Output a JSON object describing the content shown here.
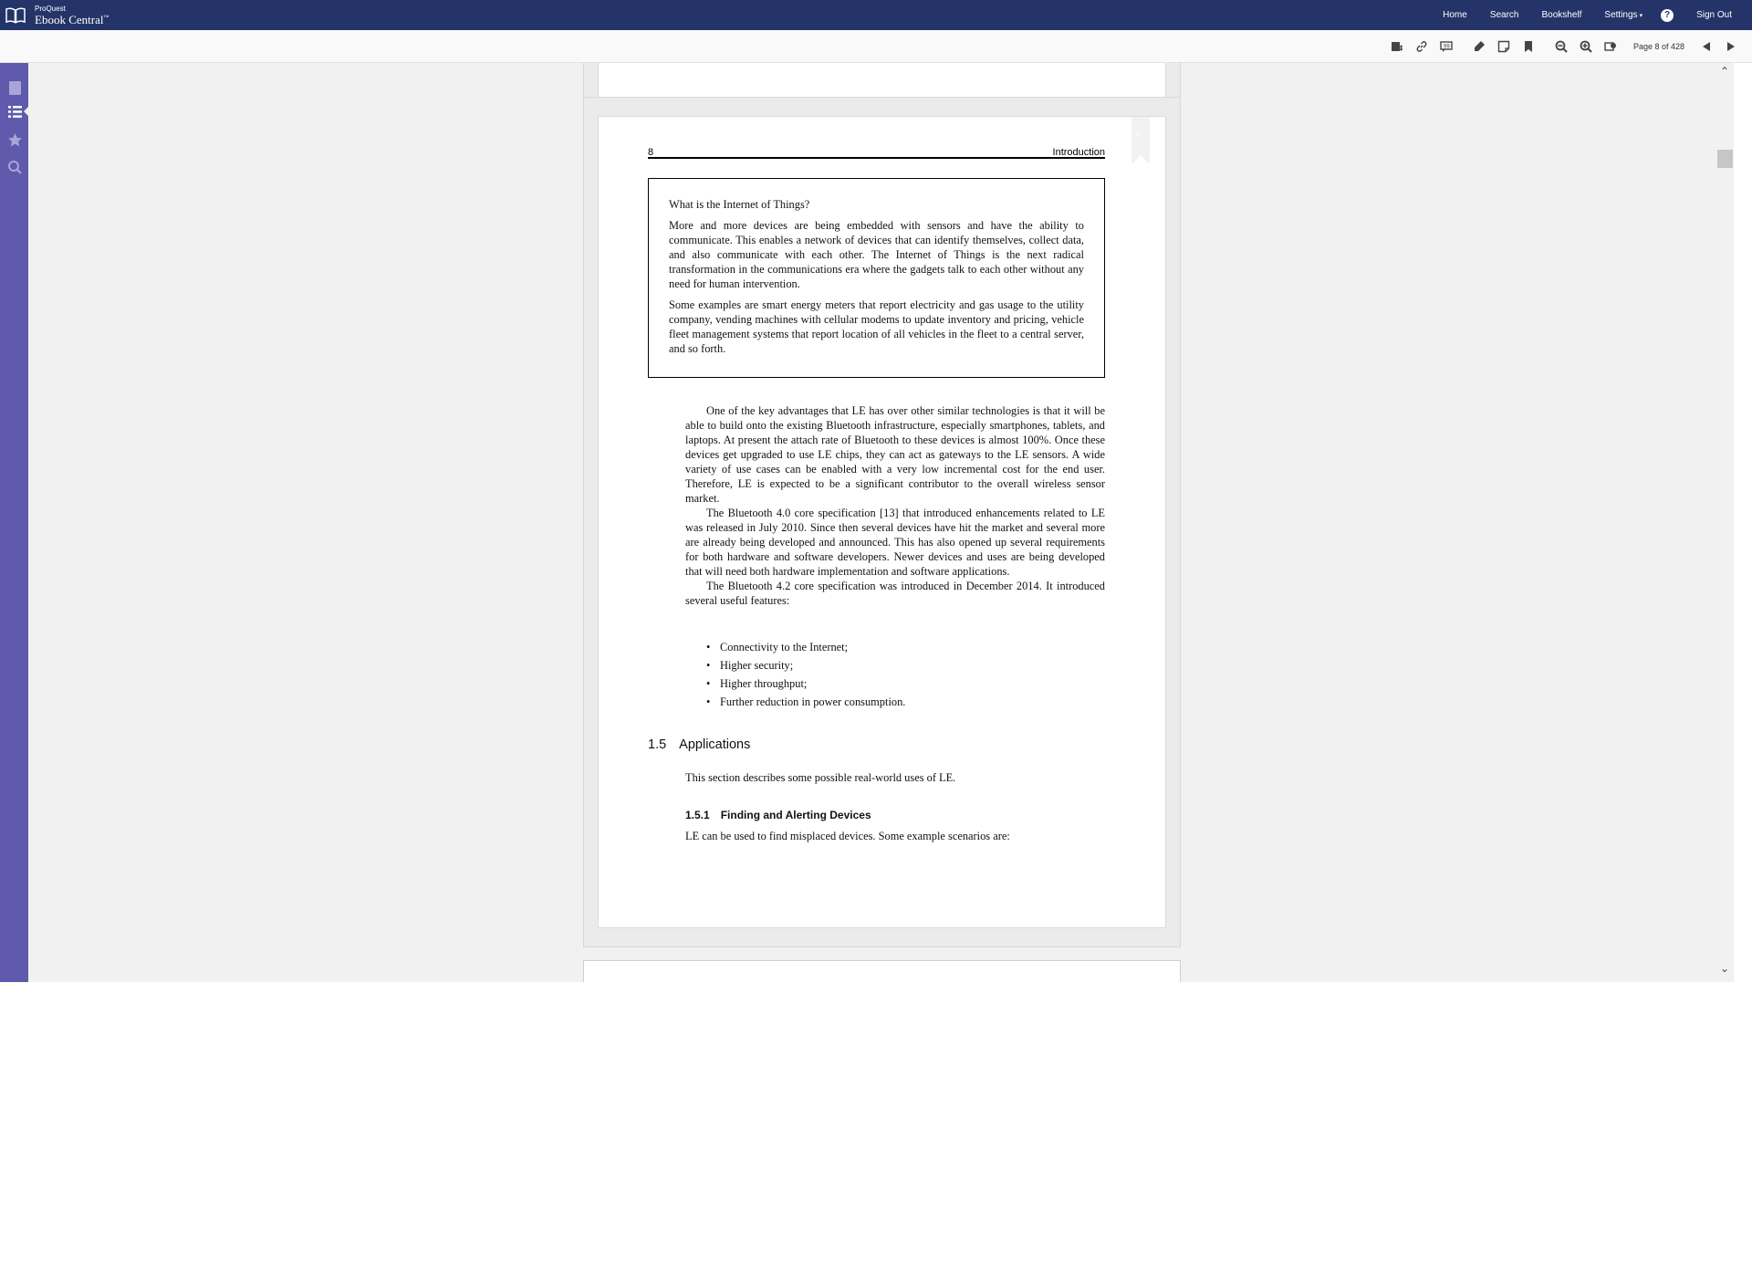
{
  "header": {
    "brand_small": "ProQuest",
    "brand_big": "Ebook Central",
    "brand_tm": "™",
    "nav": {
      "home": "Home",
      "search": "Search",
      "bookshelf": "Bookshelf",
      "settings": "Settings",
      "signout": "Sign Out"
    },
    "help": "?"
  },
  "toolbar": {
    "page_indicator": "Page 8 of 428"
  },
  "sidebar": {
    "items": [
      {
        "name": "book-icon"
      },
      {
        "name": "table-of-contents-icon"
      },
      {
        "name": "star-icon"
      },
      {
        "name": "search-icon"
      }
    ]
  },
  "page": {
    "running_head_number": "8",
    "running_head_title": "Introduction",
    "box": {
      "title": "What is the Internet of Things?",
      "para1": "More and more devices are being embedded with sensors and have the ability to communicate. This enables a network of devices that can identify themselves, collect data, and also communicate with each other. The Internet of Things is the next radical transformation in the communications era where the gadgets talk to each other without any need for human intervention.",
      "para2": "Some examples are smart energy meters that report electricity and gas usage to the utility company, vending machines with cellular modems to update inventory and pricing, vehicle fleet management systems that report location of all vehicles in the fleet to a central server, and so forth."
    },
    "body": {
      "p1": "One of the key advantages that LE has over other similar technologies is that it will be able to build onto the existing Bluetooth infrastructure, especially smartphones, tablets, and laptops. At present the attach rate of Bluetooth to these devices is almost 100%. Once these devices get upgraded to use LE chips, they can act as gateways to the LE sensors. A wide variety of use cases can be enabled with a very low incremental cost for the end user. Therefore, LE is expected to be a significant contributor to the overall wireless sensor market.",
      "p2": "The Bluetooth 4.0 core specification [13] that introduced enhancements related to LE was released in July 2010. Since then several devices have hit the market and several more are already being developed and announced. This has also opened up several requirements for both hardware and software developers. Newer devices and uses are being developed that will need both hardware implementation and software applications.",
      "p3": "The Bluetooth 4.2 core specification was introduced in December 2014. It introduced several useful features:"
    },
    "bullets": [
      "Connectivity to the Internet;",
      "Higher security;",
      "Higher throughput;",
      "Further reduction in power consumption."
    ],
    "section": {
      "number": "1.5",
      "title": "Applications",
      "text": "This section describes some possible real-world uses of LE."
    },
    "subsection": {
      "number": "1.5.1",
      "title": "Finding and Alerting Devices",
      "text": "LE can be used to find misplaced devices. Some example scenarios are:"
    }
  }
}
